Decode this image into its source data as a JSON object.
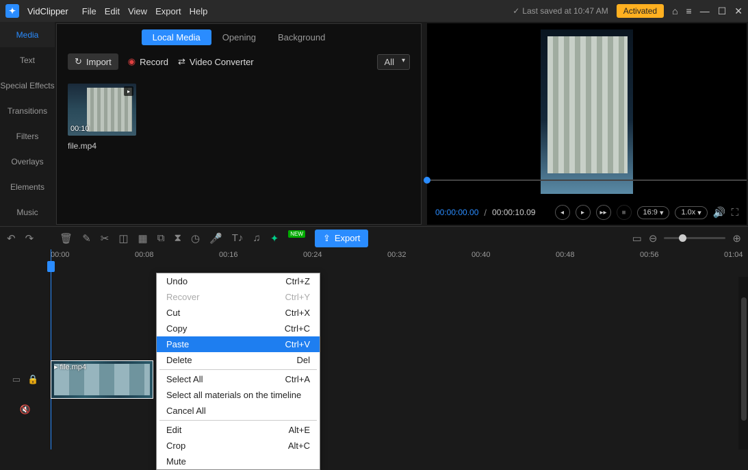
{
  "app": {
    "name": "VidClipper"
  },
  "menus": [
    "File",
    "Edit",
    "View",
    "Export",
    "Help"
  ],
  "titlebar": {
    "save_status": "Last saved at 10:47 AM",
    "activated": "Activated"
  },
  "left_tabs": [
    "Media",
    "Text",
    "Special Effects",
    "Transitions",
    "Filters",
    "Overlays",
    "Elements",
    "Music"
  ],
  "media_panel": {
    "subtabs": [
      "Local Media",
      "Opening",
      "Background"
    ],
    "import": "Import",
    "record": "Record",
    "converter": "Video Converter",
    "filter": "All",
    "clip": {
      "duration": "00:10",
      "name": "file.mp4"
    }
  },
  "preview": {
    "current": "00:00:00.00",
    "total": "00:00:10.09",
    "aspect": "16:9",
    "speed": "1.0x"
  },
  "toolbar": {
    "export": "Export",
    "new_badge": "NEW"
  },
  "ruler": [
    "00:00",
    "00:08",
    "00:16",
    "00:24",
    "00:32",
    "00:40",
    "00:48",
    "00:56",
    "01:04"
  ],
  "timeline_clip": {
    "label": "file.mp4"
  },
  "ctx": {
    "undo": {
      "label": "Undo",
      "short": "Ctrl+Z"
    },
    "recover": {
      "label": "Recover",
      "short": "Ctrl+Y"
    },
    "cut": {
      "label": "Cut",
      "short": "Ctrl+X"
    },
    "copy": {
      "label": "Copy",
      "short": "Ctrl+C"
    },
    "paste": {
      "label": "Paste",
      "short": "Ctrl+V"
    },
    "delete": {
      "label": "Delete",
      "short": "Del"
    },
    "select_all": {
      "label": "Select All",
      "short": "Ctrl+A"
    },
    "select_timeline": {
      "label": "Select all materials on the timeline"
    },
    "cancel_all": {
      "label": "Cancel All"
    },
    "edit": {
      "label": "Edit",
      "short": "Alt+E"
    },
    "crop": {
      "label": "Crop",
      "short": "Alt+C"
    },
    "mute": {
      "label": "Mute"
    }
  }
}
